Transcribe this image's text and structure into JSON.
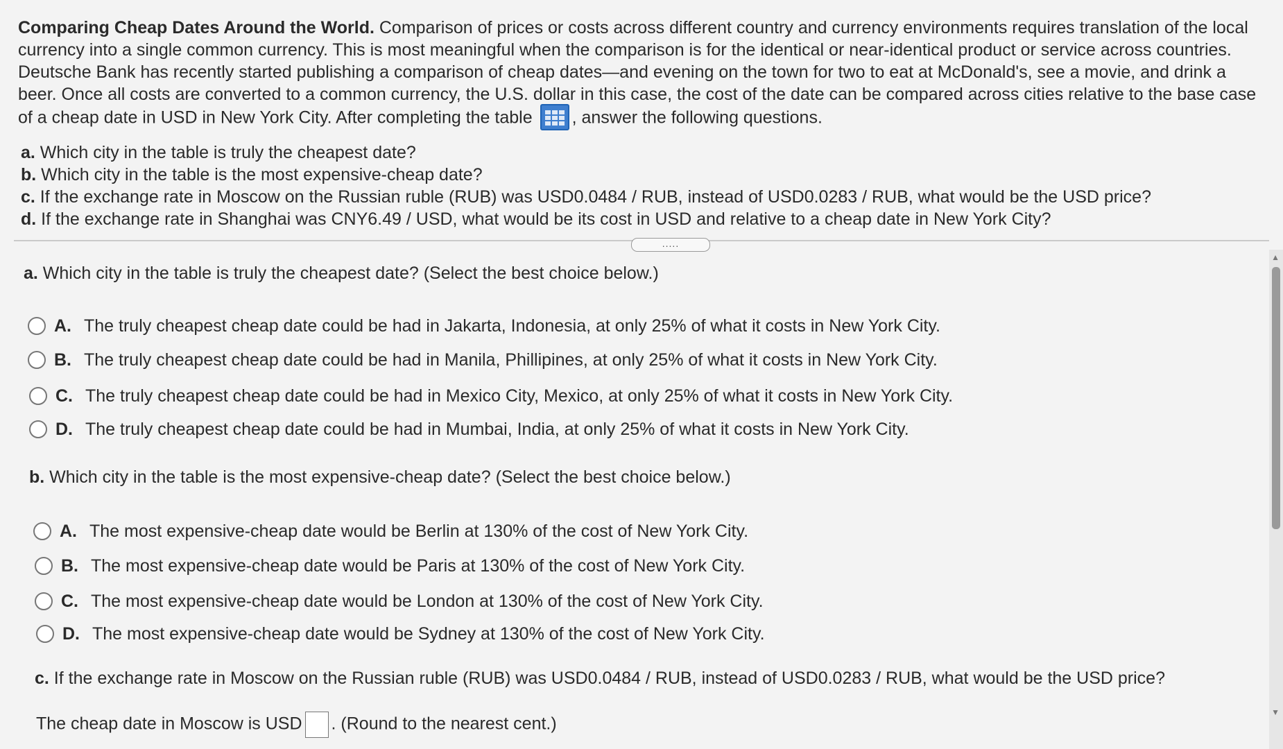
{
  "intro": {
    "title": "Comparing Cheap Dates Around the World.",
    "text": " Comparison of prices or costs across different country and currency environments requires translation of the local currency into a single common currency. This is most meaningful when the comparison is for the identical or near-identical product or service across countries. Deutsche Bank has recently started publishing a comparison of cheap dates—and evening on the town for two to eat at McDonald's, see a movie, and drink a beer. Once all costs are converted to a common currency, the U.S. dollar in this case, the cost of the date can be compared across cities relative to the base case of a cheap date in USD in New York City. After completing the table",
    "after_icon": ", answer the following questions."
  },
  "questions": [
    {
      "letter": "a.",
      "text": " Which city in the table is truly the cheapest date?"
    },
    {
      "letter": "b.",
      "text": " Which city in the table is the most expensive-cheap date?"
    },
    {
      "letter": "c.",
      "text": " If the exchange rate in Moscow on the Russian ruble (RUB) was USD0.0484 / RUB, instead of USD0.0283 / RUB, what would be the USD price?"
    },
    {
      "letter": "d.",
      "text": " If the exchange rate in Shanghai was CNY6.49 / USD, what would be its cost in USD and relative to a cheap date in New York City?"
    }
  ],
  "more_button": ".....",
  "part_a": {
    "letter": "a.",
    "question": " Which city in the table is truly the cheapest date?",
    "hint": "  (Select the best choice below.)",
    "options": [
      {
        "letter": "A.",
        "text": "The truly cheapest cheap date could be had in Jakarta, Indonesia, at only 25% of what it costs in New York City."
      },
      {
        "letter": "B.",
        "text": "The truly cheapest cheap date could be had in Manila, Phillipines, at only 25% of what it costs in New York City."
      },
      {
        "letter": "C.",
        "text": "The truly cheapest cheap date could be had in Mexico City, Mexico, at only 25% of what it costs in New York City."
      },
      {
        "letter": "D.",
        "text": "The truly cheapest cheap date could be had in Mumbai, India, at only 25% of what it costs in New York City."
      }
    ]
  },
  "part_b": {
    "letter": "b.",
    "question": " Which city in the table is the most expensive-cheap date?",
    "hint": "  (Select the best choice below.)",
    "options": [
      {
        "letter": "A.",
        "text": "The most expensive-cheap date would be Berlin at 130% of the cost of New York City."
      },
      {
        "letter": "B.",
        "text": "The most expensive-cheap date would be Paris at 130% of the cost of New York City."
      },
      {
        "letter": "C.",
        "text": "The most expensive-cheap date would be London at 130% of the cost of New York City."
      },
      {
        "letter": "D.",
        "text": "The most expensive-cheap date would be Sydney at 130% of the cost of New York City."
      }
    ]
  },
  "part_c": {
    "letter": "c.",
    "question": " If the exchange rate in Moscow on the Russian ruble (RUB) was USD0.0484 / RUB, instead of USD0.0283 / RUB, what would be the USD price?",
    "answer_prefix": "The cheap date in Moscow is USD",
    "answer_value": "",
    "answer_suffix": ".  (Round to the nearest cent.)"
  }
}
